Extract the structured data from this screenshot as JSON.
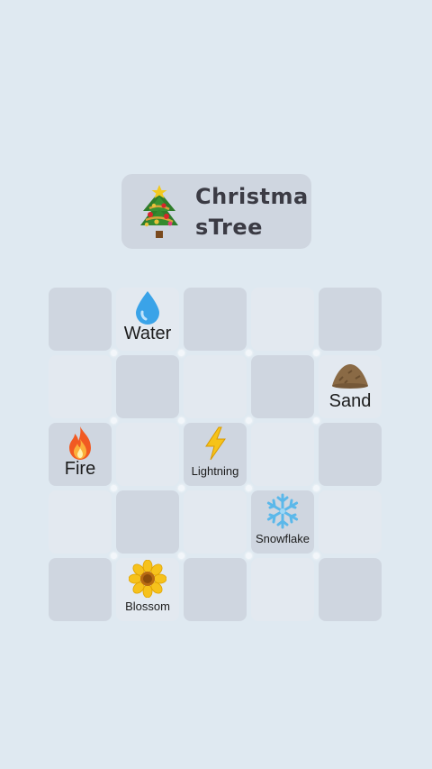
{
  "target": {
    "label": "ChristmasTree",
    "icon": "christmas-tree-icon"
  },
  "colors": {
    "background": "#dfe9f1",
    "tile_dark": "#cfd6e0",
    "tile_light": "#e3e9f0",
    "title_text": "#3b3b44"
  },
  "board": {
    "rows": 5,
    "cols": 5,
    "items": [
      {
        "label": "Water",
        "icon": "water-drop-icon",
        "row": 1,
        "col": 2
      },
      {
        "label": "Sand",
        "icon": "sand-pile-icon",
        "row": 2,
        "col": 5
      },
      {
        "label": "Fire",
        "icon": "fire-icon",
        "row": 3,
        "col": 1
      },
      {
        "label": "Lightning",
        "icon": "lightning-icon",
        "row": 3,
        "col": 3
      },
      {
        "label": "Snowflake",
        "icon": "snowflake-icon",
        "row": 4,
        "col": 4
      },
      {
        "label": "Blossom",
        "icon": "blossom-icon",
        "row": 5,
        "col": 2
      }
    ]
  }
}
